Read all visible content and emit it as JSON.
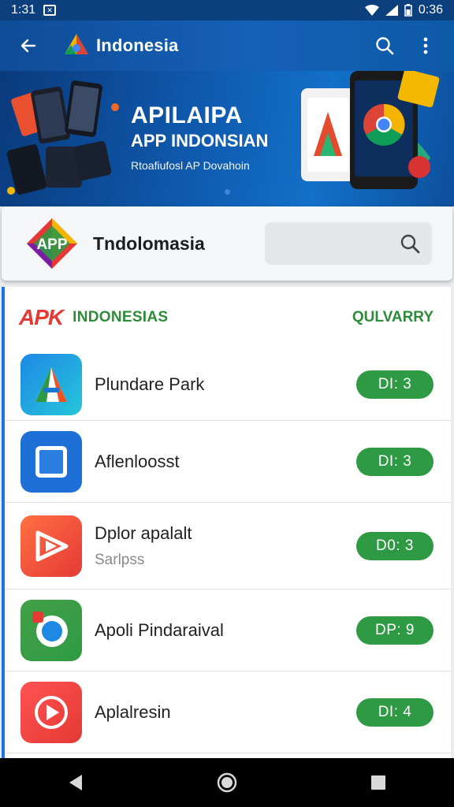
{
  "status_bar": {
    "time": "1:31",
    "right_text": "0:36"
  },
  "app_bar": {
    "title": "Indonesia"
  },
  "banner": {
    "title": "APILAIPA",
    "subtitle": "APP INDONSIAN",
    "small_text": "Rtoafiufosl AP Dovahoin"
  },
  "search_card": {
    "logo_text": "APP",
    "title": "Tndolomasia",
    "search_placeholder": ""
  },
  "list": {
    "logo_text": "APK",
    "header_title": "INDONESIAS",
    "header_right": "QULVARRY",
    "items": [
      {
        "name": "Plundare Park",
        "sub": "",
        "badge": "DI: 3"
      },
      {
        "name": "Aflenloosst",
        "sub": "",
        "badge": "DI: 3"
      },
      {
        "name": "Dplor apalalt",
        "sub": "Sarlpss",
        "badge": "D0: 3"
      },
      {
        "name": "Apoli Pindaraival",
        "sub": "",
        "badge": "DP: 9"
      },
      {
        "name": "Aplalresin",
        "sub": "",
        "badge": "DI: 4"
      }
    ]
  },
  "colors": {
    "primary": "#1560b8",
    "accent_green": "#2e9a44",
    "apk_red": "#e53935"
  }
}
